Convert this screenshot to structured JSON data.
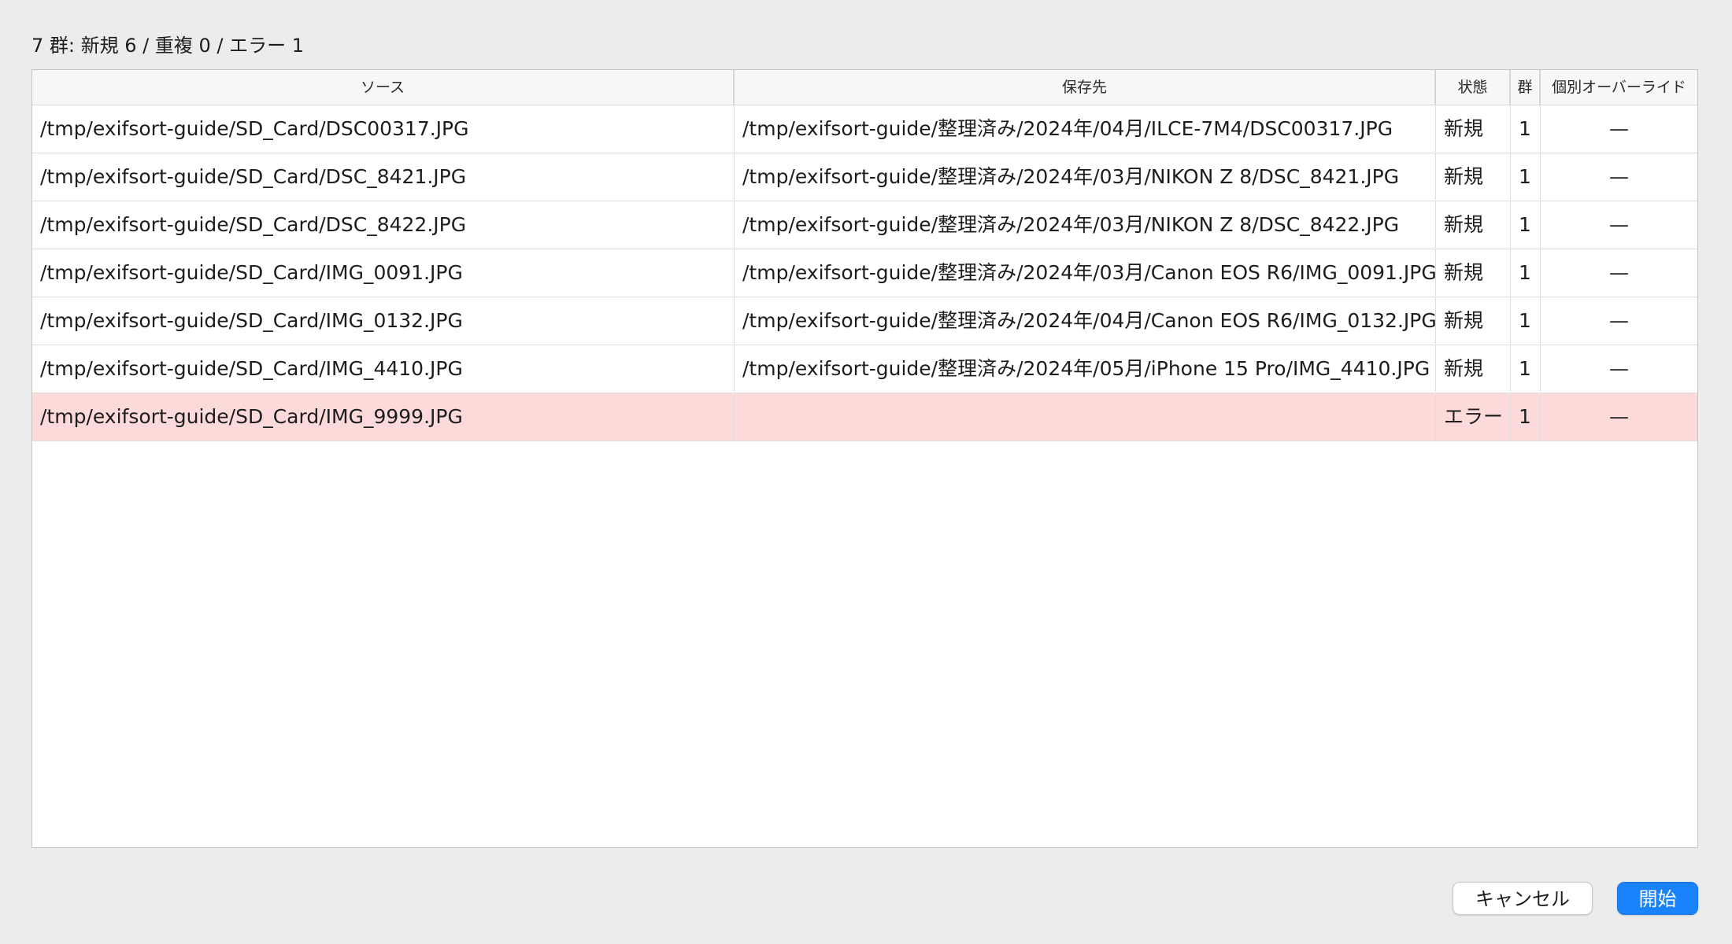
{
  "summary": "7 群: 新規 6 / 重複 0 / エラー 1",
  "table": {
    "headers": {
      "source": "ソース",
      "destination": "保存先",
      "state": "状態",
      "group": "群",
      "override": "個別オーバーライド"
    },
    "rows": [
      {
        "source": "/tmp/exifsort-guide/SD_Card/DSC00317.JPG",
        "destination": "/tmp/exifsort-guide/整理済み/2024年/04月/ILCE-7M4/DSC00317.JPG",
        "state": "新規",
        "group": "1",
        "override": "—"
      },
      {
        "source": "/tmp/exifsort-guide/SD_Card/DSC_8421.JPG",
        "destination": "/tmp/exifsort-guide/整理済み/2024年/03月/NIKON Z 8/DSC_8421.JPG",
        "state": "新規",
        "group": "1",
        "override": "—"
      },
      {
        "source": "/tmp/exifsort-guide/SD_Card/DSC_8422.JPG",
        "destination": "/tmp/exifsort-guide/整理済み/2024年/03月/NIKON Z 8/DSC_8422.JPG",
        "state": "新規",
        "group": "1",
        "override": "—"
      },
      {
        "source": "/tmp/exifsort-guide/SD_Card/IMG_0091.JPG",
        "destination": "/tmp/exifsort-guide/整理済み/2024年/03月/Canon EOS R6/IMG_0091.JPG",
        "state": "新規",
        "group": "1",
        "override": "—"
      },
      {
        "source": "/tmp/exifsort-guide/SD_Card/IMG_0132.JPG",
        "destination": "/tmp/exifsort-guide/整理済み/2024年/04月/Canon EOS R6/IMG_0132.JPG",
        "state": "新規",
        "group": "1",
        "override": "—"
      },
      {
        "source": "/tmp/exifsort-guide/SD_Card/IMG_4410.JPG",
        "destination": "/tmp/exifsort-guide/整理済み/2024年/05月/iPhone 15 Pro/IMG_4410.JPG",
        "state": "新規",
        "group": "1",
        "override": "—"
      },
      {
        "source": "/tmp/exifsort-guide/SD_Card/IMG_9999.JPG",
        "destination": "",
        "state": "エラー",
        "group": "1",
        "override": "—"
      }
    ]
  },
  "buttons": {
    "cancel": "キャンセル",
    "start": "開始"
  },
  "colors": {
    "accent": "#1a82fb",
    "error_row": "#fcdada",
    "window_bg": "#ececec"
  }
}
